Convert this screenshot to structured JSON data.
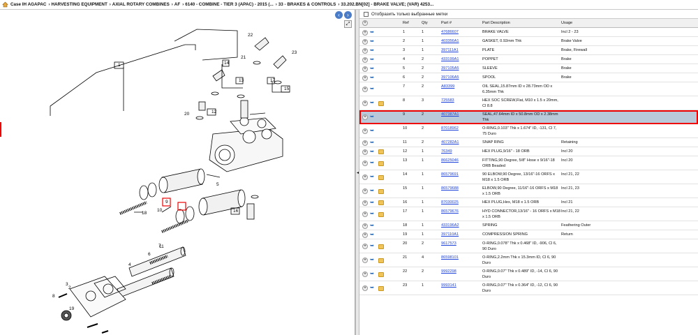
{
  "breadcrumb": [
    "Case IH AGAPAC",
    "HARVESTING EQUIPMENT",
    "AXIAL ROTARY COMBINES",
    "AF",
    "6140 - COMBINE - TIER 3 (APAC) - 2015 (...",
    "33 - BRAKES & CONTROLS",
    "33.202.BN[02] - BRAKE VALVE; (VAR) 4253..."
  ],
  "filter_label": "Отобразить только выбранные метки",
  "columns": {
    "ref": "Ref",
    "qty": "Qty",
    "part": "Part #",
    "desc": "Part Description",
    "usage": "Usage"
  },
  "colors": {
    "accent": "#1a3fd8",
    "selected_row": "#b9c9da",
    "highlight": "#e00000"
  },
  "diagram_labels": [
    "1",
    "2",
    "3",
    "4",
    "5",
    "6",
    "7",
    "8",
    "9",
    "10",
    "11",
    "12",
    "13",
    "14",
    "15",
    "16",
    "17",
    "18",
    "19",
    "20",
    "21",
    "22",
    "23"
  ],
  "rows": [
    {
      "ref": "1",
      "qty": "1",
      "part": "47686607",
      "desc": "BRAKE VALVE",
      "usage": "Incl 2 - 23",
      "kit": false
    },
    {
      "ref": "2",
      "qty": "1",
      "part": "403356A1",
      "desc": "GASKET, 0.92mm Thk",
      "usage": "Brake Valve",
      "kit": false
    },
    {
      "ref": "3",
      "qty": "1",
      "part": "397111A1",
      "desc": "PLATE",
      "usage": "Brake, Firewall",
      "kit": false
    },
    {
      "ref": "4",
      "qty": "2",
      "part": "433199A1",
      "desc": "POPPET",
      "usage": "Brake",
      "kit": false
    },
    {
      "ref": "5",
      "qty": "2",
      "part": "397105A5",
      "desc": "SLEEVE",
      "usage": "Brake",
      "kit": false
    },
    {
      "ref": "6",
      "qty": "2",
      "part": "397106A5",
      "desc": "SPOOL",
      "usage": "Brake",
      "kit": false
    },
    {
      "ref": "7",
      "qty": "2",
      "part": "A83399",
      "desc": "OIL SEAL,15.87mm ID x 28.73mm OD x 6.35mm Thk",
      "usage": "",
      "kit": false
    },
    {
      "ref": "8",
      "qty": "3",
      "part": "725583",
      "desc": "HEX SOC SCREW,Flat, M10 x 1.5 x 20mm, Cl 8.8",
      "usage": "",
      "kit": true
    },
    {
      "ref": "9",
      "qty": "2",
      "part": "407387A1",
      "desc": "SEAL,47.64mm ID x 50.8mm OD x 2.38mm Thk",
      "usage": "",
      "kit": false,
      "selected": true
    },
    {
      "ref": "10",
      "qty": "2",
      "part": "87018962",
      "desc": "O-RING,0.103\" Thk x 1.674\" ID, -131, Cl 7, 75 Duro",
      "usage": "",
      "kit": false
    },
    {
      "ref": "11",
      "qty": "2",
      "part": "407282A1",
      "desc": "SNAP RING",
      "usage": "Retaining",
      "kit": false
    },
    {
      "ref": "12",
      "qty": "1",
      "part": "76349",
      "desc": "HEX PLUG,9/16\" - 18 ORB",
      "usage": "Incl 20",
      "kit": true
    },
    {
      "ref": "13",
      "qty": "1",
      "part": "86625046",
      "desc": "FITTING,90 Degree, 5/8\" Hose x 9/16\"-18 ORB Beaded",
      "usage": "Incl 20",
      "kit": true
    },
    {
      "ref": "14",
      "qty": "1",
      "part": "86579691",
      "desc": "90 ELBOW,90 Degree, 13/16\"-16 ORFS x M18 x 1.5 ORB",
      "usage": "Incl 21, 22",
      "kit": true
    },
    {
      "ref": "15",
      "qty": "1",
      "part": "86579688",
      "desc": "ELBOW,90 Degree, 11/16\"-16 ORFS x M18 x 1.5 ORB",
      "usage": "Incl 21, 23",
      "kit": true
    },
    {
      "ref": "16",
      "qty": "1",
      "part": "87030025",
      "desc": "HEX PLUG,Hex, M18 x 1.5 ORB",
      "usage": "Incl 21",
      "kit": true
    },
    {
      "ref": "17",
      "qty": "1",
      "part": "86579676",
      "desc": "HYD CONNECTOR,13/16\" - 16 ORFS x M18 x 1.5 ORB",
      "usage": "Incl 21, 22",
      "kit": true
    },
    {
      "ref": "18",
      "qty": "1",
      "part": "433196A2",
      "desc": "SPRING",
      "usage": "Feathering Outer",
      "kit": false
    },
    {
      "ref": "19",
      "qty": "1",
      "part": "397110A1",
      "desc": "COMPRESSION SPRING",
      "usage": "Return",
      "kit": false
    },
    {
      "ref": "20",
      "qty": "2",
      "part": "9617573",
      "desc": "O-RING,0.078\" Thk x 0.468\" ID, -906, Cl 6, 90 Duro",
      "usage": "",
      "kit": true
    },
    {
      "ref": "21",
      "qty": "4",
      "part": "86598101",
      "desc": "O-RING,2.2mm Thk x 15.3mm ID, Cl 6, 90 Duro",
      "usage": "",
      "kit": true
    },
    {
      "ref": "22",
      "qty": "2",
      "part": "9992298",
      "desc": "O-RING,0.07\" Thk x 0.489\" ID, -14, Cl 6, 90 Duro",
      "usage": "",
      "kit": true
    },
    {
      "ref": "23",
      "qty": "1",
      "part": "9993141",
      "desc": "O-RING,0.07\" Thk x 0.364\" ID, -12, Cl 6, 90 Duro",
      "usage": "",
      "kit": true
    }
  ]
}
